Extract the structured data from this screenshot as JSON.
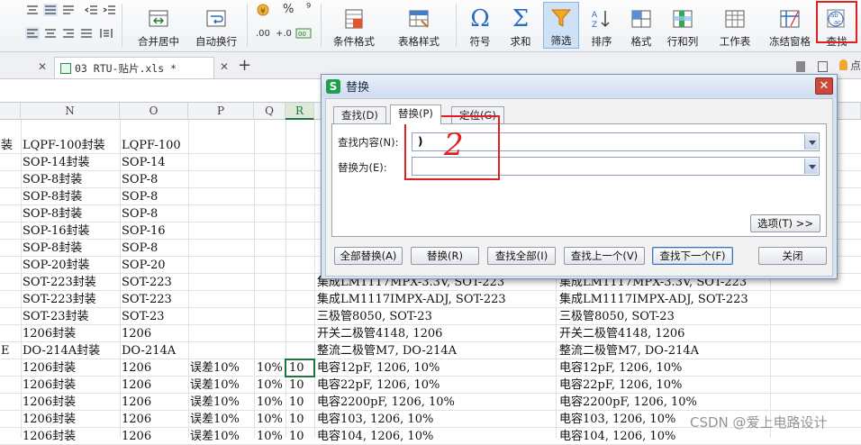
{
  "ribbon": {
    "buttons": [
      {
        "id": "merge",
        "label": "合并居中"
      },
      {
        "id": "wrap",
        "label": "自动换行"
      },
      {
        "id": "condfmt",
        "label": "条件格式"
      },
      {
        "id": "tblstyle",
        "label": "表格样式"
      },
      {
        "id": "symbol",
        "label": "符号"
      },
      {
        "id": "sum",
        "label": "求和"
      },
      {
        "id": "filter",
        "label": "筛选"
      },
      {
        "id": "sort",
        "label": "排序"
      },
      {
        "id": "format",
        "label": "格式"
      },
      {
        "id": "rowcol",
        "label": "行和列"
      },
      {
        "id": "sheet",
        "label": "工作表"
      },
      {
        "id": "freeze",
        "label": "冻结窗格"
      },
      {
        "id": "find",
        "label": "查找"
      }
    ],
    "percent": "%",
    "comma": "⁹",
    "decimals_up": ".00",
    "decimals_down": "+.0"
  },
  "tabs": {
    "file_label": "03 RTU-贴片.xls *",
    "add_label": "+",
    "right_text": "点"
  },
  "columns": [
    "N",
    "O",
    "P",
    "Q",
    "R"
  ],
  "rows": [
    {
      "m": "装",
      "n": "LQPF-100封装",
      "o": "LQPF-100",
      "p": "",
      "q": "",
      "r": "",
      "s": "",
      "t": ""
    },
    {
      "m": "",
      "n": "SOP-14封装",
      "o": "SOP-14",
      "p": "",
      "q": "",
      "r": "",
      "s": "",
      "t": ""
    },
    {
      "m": "",
      "n": "SOP-8封装",
      "o": "SOP-8",
      "p": "",
      "q": "",
      "r": "",
      "s": "",
      "t": ""
    },
    {
      "m": "",
      "n": "SOP-8封装",
      "o": "SOP-8",
      "p": "",
      "q": "",
      "r": "",
      "s": "",
      "t": ""
    },
    {
      "m": "",
      "n": "SOP-8封装",
      "o": "SOP-8",
      "p": "",
      "q": "",
      "r": "",
      "s": "",
      "t": ""
    },
    {
      "m": "",
      "n": "SOP-16封装",
      "o": "SOP-16",
      "p": "",
      "q": "",
      "r": "",
      "s": "",
      "t": ""
    },
    {
      "m": "",
      "n": "SOP-8封装",
      "o": "SOP-8",
      "p": "",
      "q": "",
      "r": "",
      "s": "",
      "t": ""
    },
    {
      "m": "",
      "n": "SOP-20封装",
      "o": "SOP-20",
      "p": "",
      "q": "",
      "r": "",
      "s": "",
      "t": ""
    },
    {
      "m": "",
      "n": "SOT-223封装",
      "o": "SOT-223",
      "p": "",
      "q": "",
      "r": "",
      "s": "集成LM1117MPX-3.3V, SOT-223",
      "t": "集成LM1117MPX-3.3V, SOT-223"
    },
    {
      "m": "",
      "n": "SOT-223封装",
      "o": "SOT-223",
      "p": "",
      "q": "",
      "r": "",
      "s": "集成LM1117IMPX-ADJ, SOT-223",
      "t": "集成LM1117IMPX-ADJ, SOT-223"
    },
    {
      "m": "",
      "n": "SOT-23封装",
      "o": "SOT-23",
      "p": "",
      "q": "",
      "r": "",
      "s": "三极管8050, SOT-23",
      "t": "三极管8050, SOT-23"
    },
    {
      "m": "",
      "n": "1206封装",
      "o": "1206",
      "p": "",
      "q": "",
      "r": "",
      "s": "开关二极管4148, 1206",
      "t": "开关二极管4148, 1206"
    },
    {
      "m": "E",
      "n": "DO-214A封装",
      "o": "DO-214A",
      "p": "",
      "q": "",
      "r": "",
      "s": "整流二极管M7, DO-214A",
      "t": "整流二极管M7, DO-214A"
    },
    {
      "m": "",
      "n": "1206封装",
      "o": "1206",
      "p": "误差10%",
      "q": "10%",
      "r": "10",
      "s": "电容12pF, 1206, 10%",
      "t": "电容12pF, 1206, 10%"
    },
    {
      "m": "",
      "n": "1206封装",
      "o": "1206",
      "p": "误差10%",
      "q": "10%",
      "r": "10",
      "s": "电容22pF, 1206, 10%",
      "t": "电容22pF, 1206, 10%"
    },
    {
      "m": "",
      "n": "1206封装",
      "o": "1206",
      "p": "误差10%",
      "q": "10%",
      "r": "10",
      "s": "电容2200pF, 1206, 10%",
      "t": "电容2200pF, 1206, 10%"
    },
    {
      "m": "",
      "n": "1206封装",
      "o": "1206",
      "p": "误差10%",
      "q": "10%",
      "r": "10",
      "s": "电容103, 1206, 10%",
      "t": "电容103, 1206, 10%"
    },
    {
      "m": "",
      "n": "1206封装",
      "o": "1206",
      "p": "误差10%",
      "q": "10%",
      "r": "10",
      "s": "电容104, 1206, 10%",
      "t": "电容104, 1206, 10%"
    }
  ],
  "dialog": {
    "title": "替换",
    "close": "✕",
    "tabs": [
      "查找(D)",
      "替换(P)",
      "定位(G)"
    ],
    "find_label": "查找内容(N):",
    "find_value": ")",
    "replace_label": "替换为(E):",
    "replace_value": "",
    "options_btn": "选项(T) >>",
    "buttons": [
      "全部替换(A)",
      "替换(R)",
      "查找全部(I)",
      "查找上一个(V)",
      "查找下一个(F)",
      "关闭"
    ]
  },
  "annotation_mark": "2",
  "watermark": "CSDN @爱上电路设计",
  "colors": {
    "accent": "#217346",
    "annotation": "#e02020",
    "filter_active": "#f5a623"
  }
}
